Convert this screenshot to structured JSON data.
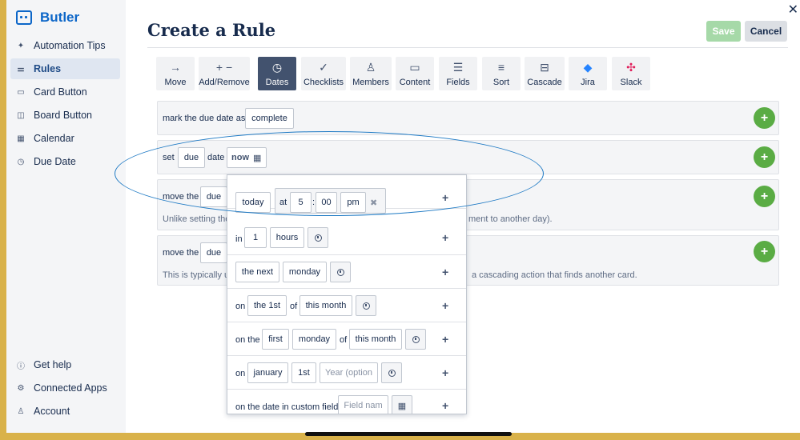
{
  "brand": {
    "name": "Butler"
  },
  "sidebar": {
    "top_items": [
      {
        "label": "Automation Tips",
        "icon": "sparkle-icon"
      },
      {
        "label": "Rules",
        "icon": "sliders-icon"
      },
      {
        "label": "Card Button",
        "icon": "card-icon"
      },
      {
        "label": "Board Button",
        "icon": "board-icon"
      },
      {
        "label": "Calendar",
        "icon": "calendar-icon"
      },
      {
        "label": "Due Date",
        "icon": "clock-icon"
      }
    ],
    "bottom_items": [
      {
        "label": "Get help",
        "icon": "help-icon"
      },
      {
        "label": "Connected Apps",
        "icon": "gear-icon"
      },
      {
        "label": "Account",
        "icon": "user-icon"
      }
    ]
  },
  "header": {
    "title": "Create a Rule",
    "save_label": "Save",
    "cancel_label": "Cancel",
    "close_label": "✕"
  },
  "toolbar": {
    "items": [
      {
        "label": "Move",
        "icon": "arrow-right-icon",
        "glyph": "→"
      },
      {
        "label": "Add/Remove",
        "icon": "plus-minus-icon",
        "glyph": "+ −"
      },
      {
        "label": "Dates",
        "icon": "clock-icon",
        "glyph": "◷"
      },
      {
        "label": "Checklists",
        "icon": "check-icon",
        "glyph": "✓"
      },
      {
        "label": "Members",
        "icon": "user-icon",
        "glyph": "♙"
      },
      {
        "label": "Content",
        "icon": "comment-icon",
        "glyph": "▭"
      },
      {
        "label": "Fields",
        "icon": "fields-icon",
        "glyph": "☰"
      },
      {
        "label": "Sort",
        "icon": "sort-icon",
        "glyph": "≡"
      },
      {
        "label": "Cascade",
        "icon": "cascade-icon",
        "glyph": "⊟"
      },
      {
        "label": "Jira",
        "icon": "jira-icon",
        "glyph": "◆"
      },
      {
        "label": "Slack",
        "icon": "slack-icon",
        "glyph": "✣"
      }
    ],
    "active": "Dates"
  },
  "rows": {
    "r1": {
      "text": "mark the due date as",
      "value": "complete"
    },
    "r2": {
      "text_set": "set",
      "value_field": "due",
      "text_date": "date",
      "value_when": "now"
    },
    "r3": {
      "text": "move the",
      "value": "due",
      "hint_left": "Unlike setting the",
      "hint_right": "ment to another day)."
    },
    "r4": {
      "text": "move the",
      "value": "due",
      "hint_left": "This is typically u",
      "hint_right": "a cascading action that finds another card."
    },
    "add_label": "+"
  },
  "popup": {
    "row1": {
      "day": "today",
      "at": "at",
      "hour": "5",
      "colon": ":",
      "minute": "00",
      "ampm": "pm",
      "clear": "✖"
    },
    "row2": {
      "in": "in",
      "amount": "1",
      "unit": "hours"
    },
    "row3": {
      "which": "the next",
      "weekday": "monday"
    },
    "row4": {
      "on": "on",
      "nth": "the 1st",
      "of": "of",
      "period": "this month"
    },
    "row5": {
      "on_the": "on the",
      "ordinal": "first",
      "weekday": "monday",
      "of": "of",
      "period": "this month"
    },
    "row6": {
      "on": "on",
      "month": "january",
      "day": "1st",
      "year_placeholder": "Year (option"
    },
    "row7": {
      "text": "on the date in custom field",
      "field_placeholder": "Field nam"
    },
    "plus": "+"
  },
  "colors": {
    "accent": "#0c66c8",
    "add": "#5aac44",
    "active_tab": "#42526e",
    "annotation": "#1f7ac4"
  }
}
